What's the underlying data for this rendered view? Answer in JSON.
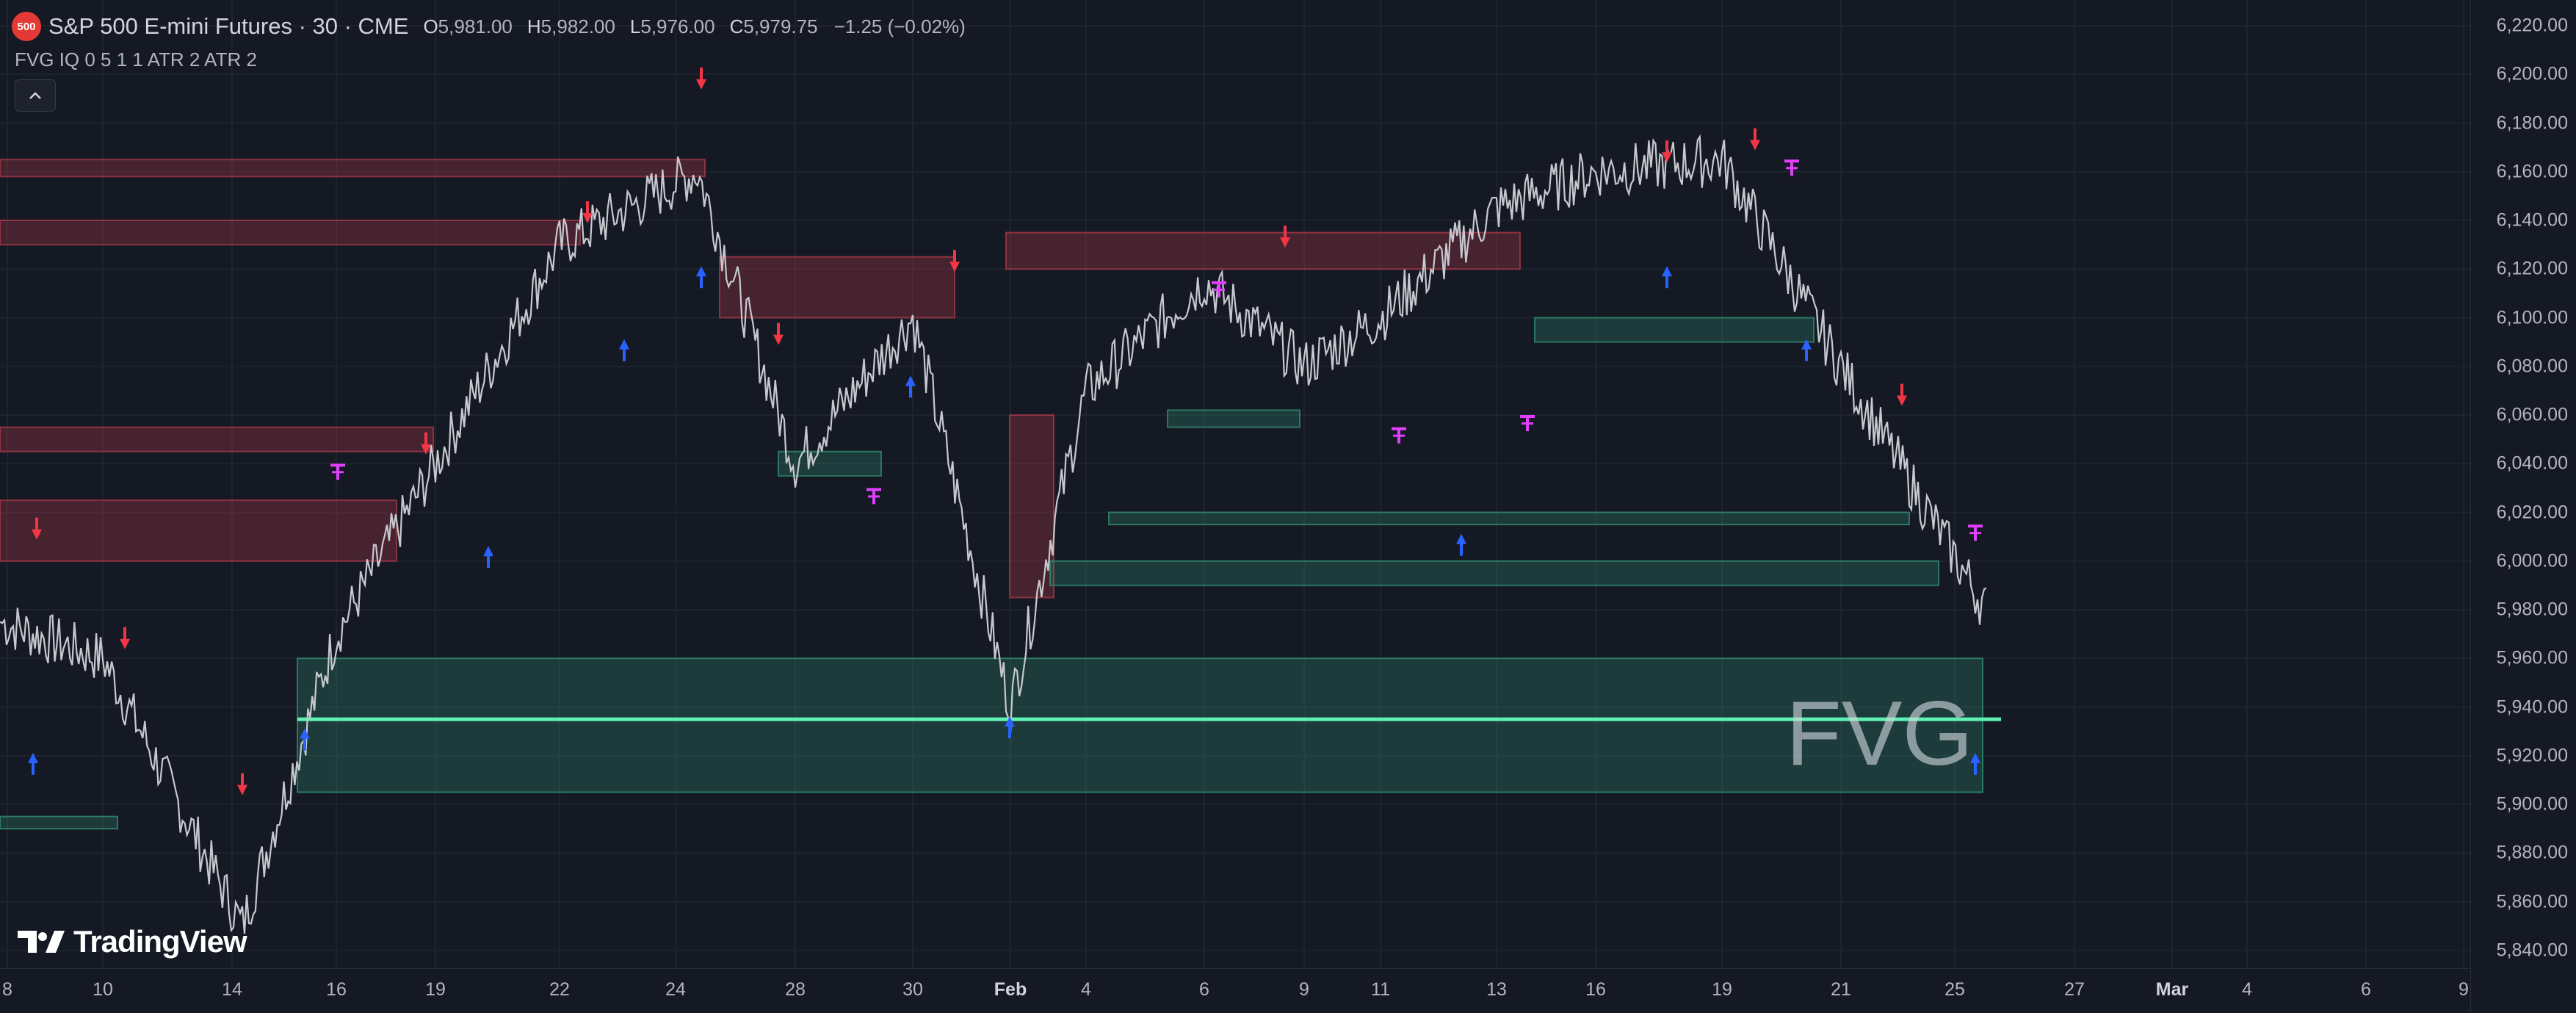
{
  "header": {
    "logo_text": "500",
    "symbol": "S&P 500 E-mini Futures · 30 · CME",
    "ohlc": [
      {
        "k": "O",
        "v": "5,981.00"
      },
      {
        "k": "H",
        "v": "5,982.00"
      },
      {
        "k": "L",
        "v": "5,976.00"
      },
      {
        "k": "C",
        "v": "5,979.75"
      }
    ],
    "change": "−1.25 (−0.02%)"
  },
  "indicator": {
    "label": "FVG IQ 0 5 1 1 ATR 2 ATR 2",
    "collapse_icon": "chevron-up-icon"
  },
  "watermark": "FVG",
  "brand": "TradingView",
  "price_axis": [
    "6,220.00",
    "6,200.00",
    "6,180.00",
    "6,160.00",
    "6,140.00",
    "6,120.00",
    "6,100.00",
    "6,080.00",
    "6,060.00",
    "6,040.00",
    "6,020.00",
    "6,000.00",
    "5,980.00",
    "5,960.00",
    "5,940.00",
    "5,920.00",
    "5,900.00",
    "5,880.00",
    "5,860.00",
    "5,840.00"
  ],
  "time_axis": [
    "8",
    "10",
    "14",
    "16",
    "19",
    "22",
    "24",
    "28",
    "30",
    "Feb",
    "4",
    "6",
    "9",
    "11",
    "13",
    "16",
    "19",
    "21",
    "25",
    "27",
    "Mar",
    "4",
    "6",
    "9"
  ],
  "colors": {
    "background": "#151924",
    "price_line": "#c7c9cf",
    "bearish_fvg": "#b23b4a",
    "bullish_fvg": "#2e8c6e",
    "highlight_line": "#5ff0b4",
    "down_arrow": "#f23645",
    "up_arrow": "#2962ff",
    "magenta_marker": "#e040fb"
  },
  "chart_data": {
    "type": "line",
    "symbol": "S&P 500 E-mini Futures",
    "interval": "30",
    "ylim": [
      5840,
      6220
    ],
    "x": [
      "10",
      "14",
      "16",
      "19",
      "22",
      "24",
      "28",
      "30",
      "Feb",
      "4",
      "6",
      "9",
      "11",
      "13",
      "16",
      "19",
      "21",
      "25"
    ],
    "series": [
      {
        "values": [
          5960,
          5850,
          5970,
          6040,
          6130,
          6160,
          6040,
          6100,
          5940,
          6070,
          6115,
          6080,
          6100,
          6145,
          6160,
          6165,
          6080,
          5980
        ]
      }
    ],
    "bearish_fvg_zones": [
      [
        6158,
        6165
      ],
      [
        6130,
        6140
      ],
      [
        6100,
        6125
      ],
      [
        6120,
        6135
      ],
      [
        6045,
        6055
      ],
      [
        6000,
        6025
      ],
      [
        5985,
        6060
      ]
    ],
    "bullish_fvg_zones": [
      [
        5905,
        5960
      ],
      [
        5990,
        6000
      ],
      [
        6015,
        6020
      ],
      [
        6090,
        6100
      ],
      [
        6055,
        6062
      ],
      [
        6035,
        6045
      ],
      [
        5890,
        5895
      ]
    ],
    "highlight_level": 5935,
    "grid": true
  }
}
